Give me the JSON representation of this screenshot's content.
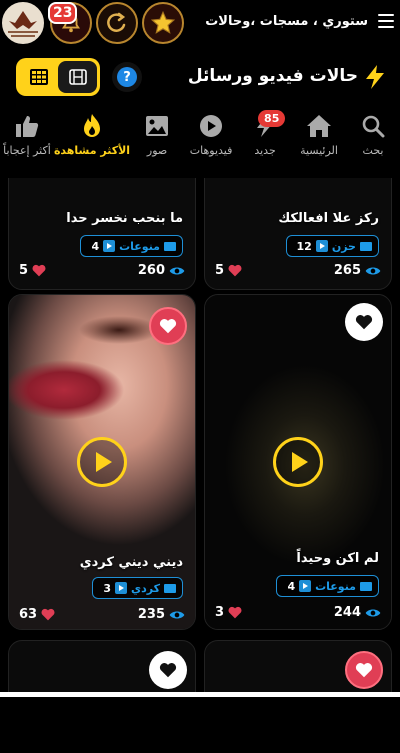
{
  "header": {
    "notifications_count": "23",
    "app_subtitle": "ستوري ، مسجات ،وحالات"
  },
  "section": {
    "title": "حالات فيديو ورسائل",
    "help": "?"
  },
  "tabs": [
    {
      "label": "بحث",
      "icon": "search-icon"
    },
    {
      "label": "الرئيسية",
      "icon": "home-icon"
    },
    {
      "label": "جديد",
      "icon": "bolt-icon",
      "badge": "85"
    },
    {
      "label": "فيديوهات",
      "icon": "play-circle-icon"
    },
    {
      "label": "صور",
      "icon": "image-icon"
    },
    {
      "label": "الأكثر مشاهدة",
      "icon": "fire-icon",
      "active": true
    },
    {
      "label": "أكثر إعجاباً",
      "icon": "thumbs-up-icon"
    }
  ],
  "cards": [
    {
      "name": "ركز علا افعالكك",
      "category": "حزن",
      "cat_count": "12",
      "views": "265",
      "likes": "5"
    },
    {
      "name": "ما بنحب نخسر حدا",
      "category": "منوعات",
      "cat_count": "4",
      "views": "260",
      "likes": "5"
    },
    {
      "name": "لم اكن وحيداً",
      "category": "منوعات",
      "cat_count": "4",
      "views": "244",
      "likes": "3"
    },
    {
      "name": "ديني ديني كردي",
      "category": "كردي",
      "cat_count": "3",
      "views": "235",
      "likes": "63"
    }
  ],
  "colors": {
    "accent": "#ffd21a",
    "badge": "#e53935",
    "category": "#1e9be8",
    "heart": "#e03e55"
  }
}
